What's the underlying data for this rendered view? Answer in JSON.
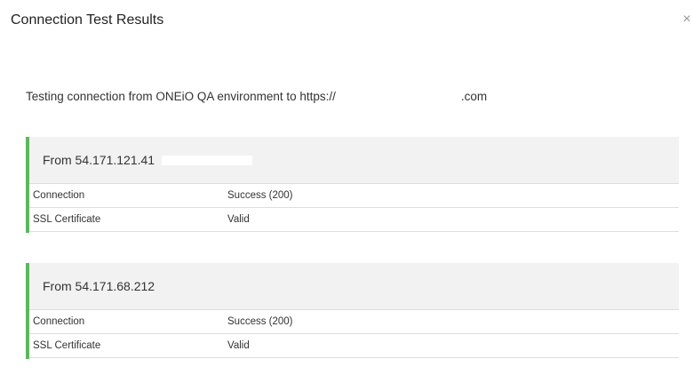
{
  "dialog": {
    "title": "Connection Test Results",
    "close_icon": "close-icon",
    "close_glyph": "×"
  },
  "intro": {
    "prefix": "Testing connection from ONEiO QA environment to https://",
    "suffix": ".com"
  },
  "results": [
    {
      "header": "From 54.171.121.41",
      "rows": [
        {
          "label": "Connection",
          "value": "Success (200)"
        },
        {
          "label": "SSL Certificate",
          "value": "Valid"
        }
      ]
    },
    {
      "header": "From 54.171.68.212",
      "rows": [
        {
          "label": "Connection",
          "value": "Success (200)"
        },
        {
          "label": "SSL Certificate",
          "value": "Valid"
        }
      ]
    }
  ],
  "colors": {
    "success_accent": "#5cb85c",
    "header_bg": "#f2f2f2"
  }
}
